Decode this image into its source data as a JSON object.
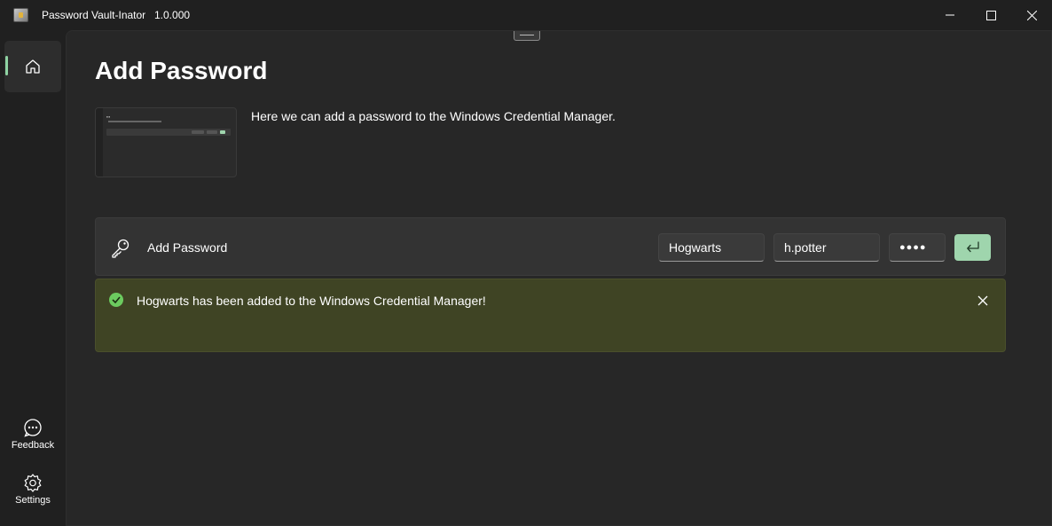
{
  "titlebar": {
    "title": "Password Vault-Inator",
    "version": "1.0.000"
  },
  "sidebar": {
    "items": [
      {
        "label": "Feedback",
        "icon": "chat-icon"
      },
      {
        "label": "Settings",
        "icon": "gear-icon"
      }
    ]
  },
  "page": {
    "title": "Add Password",
    "description": "Here we can add a password to the Windows Credential Manager."
  },
  "card": {
    "label": "Add Password",
    "site_value": "Hogwarts",
    "username_value": "h.potter",
    "password_value": "●●●●"
  },
  "infobar": {
    "message": "Hogwarts has been added to the Windows Credential Manager!"
  },
  "colors": {
    "accent": "#9fd5ad",
    "success_bg": "#3f4424",
    "success_icon": "#6ccb5f"
  }
}
